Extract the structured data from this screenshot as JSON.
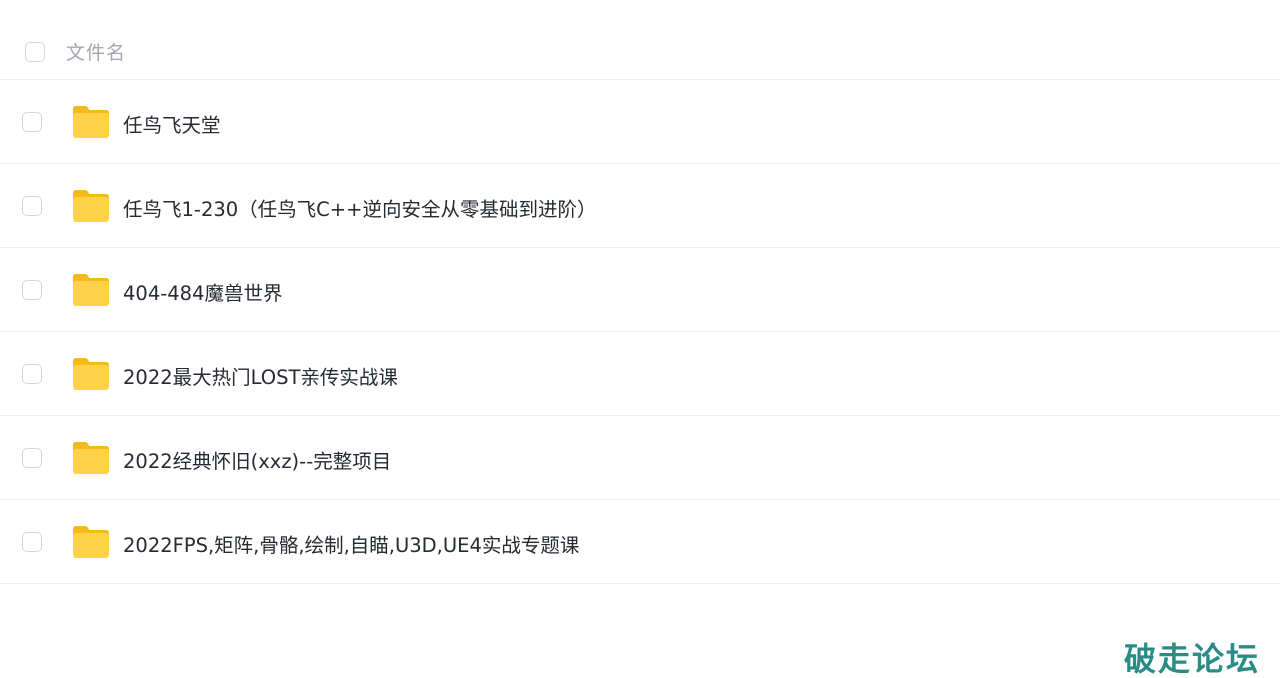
{
  "header": {
    "name_column_label": "文件名"
  },
  "files": [
    {
      "name": "任鸟飞天堂",
      "icon": "folder-icon"
    },
    {
      "name": "任鸟飞1-230（任鸟飞C++逆向安全从零基础到进阶）",
      "icon": "folder-icon"
    },
    {
      "name": "404-484魔兽世界",
      "icon": "folder-icon"
    },
    {
      "name": "2022最大热门LOST亲传实战课",
      "icon": "folder-icon"
    },
    {
      "name": "2022经典怀旧(xxz)--完整项目",
      "icon": "folder-icon"
    },
    {
      "name": "2022FPS,矩阵,骨骼,绘制,自瞄,U3D,UE4实战专题课",
      "icon": "folder-icon"
    }
  ],
  "watermark": "破走论坛",
  "colors": {
    "folder_light": "#ffd24a",
    "folder_dark": "#f5b91c",
    "watermark": "#2b8c86",
    "text": "#262a33",
    "header_text": "#a1a7b3"
  }
}
